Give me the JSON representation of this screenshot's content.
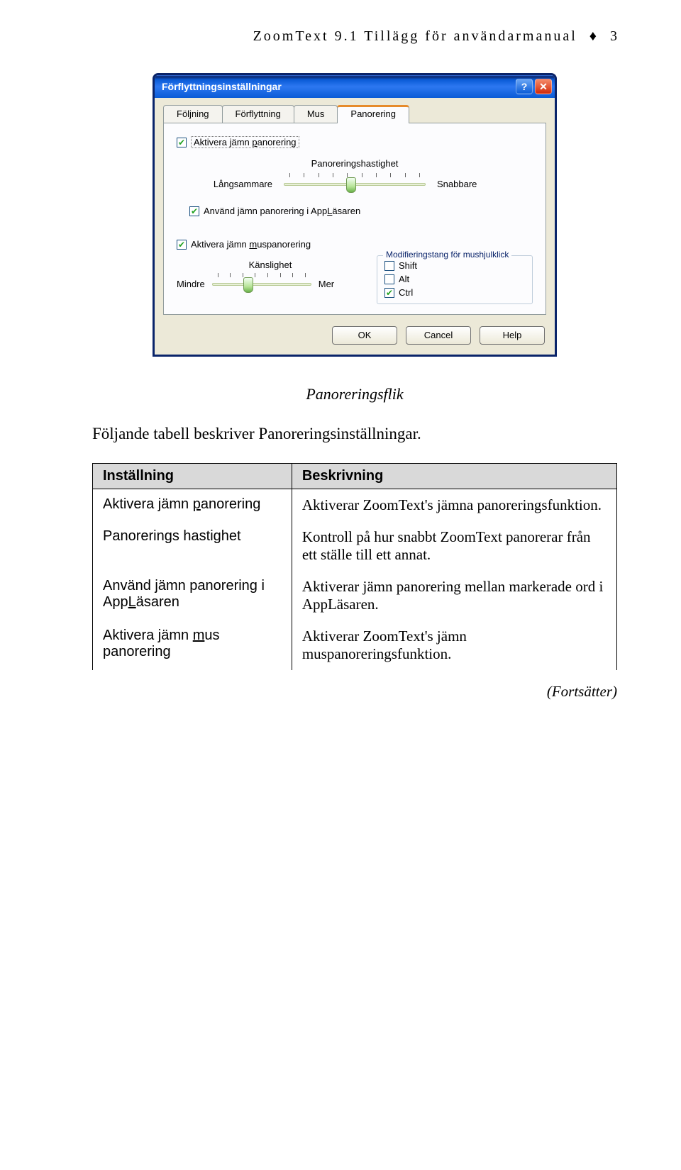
{
  "header": {
    "title": "ZoomText 9.1 Tillägg för användarmanual",
    "separator": "♦",
    "page_number": "3"
  },
  "dialog": {
    "title": "Förflyttningsinställningar",
    "tabs": [
      "Följning",
      "Förflyttning",
      "Mus",
      "Panorering"
    ],
    "active_tab": "Panorering",
    "cb_enable": "Aktivera jämn panorering",
    "group1_title": "Panoreringshastighet",
    "slider1_left": "Långsammare",
    "slider1_right": "Snabbare",
    "cb_applasaren": "Använd jämn panorering i AppLäsaren",
    "cb_mouse": "Aktivera jämn muspanorering",
    "sens_title": "Känslighet",
    "sens_left": "Mindre",
    "sens_right": "Mer",
    "mod_legend": "Modifieringstang för mushjulklick",
    "mod_shift": "Shift",
    "mod_alt": "Alt",
    "mod_ctrl": "Ctrl",
    "btn_ok": "OK",
    "btn_cancel": "Cancel",
    "btn_help": "Help"
  },
  "caption": "Panoreringsflik",
  "intro_text": "Följande tabell beskriver Panoreringsinställningar.",
  "table": {
    "header_setting": "Inställning",
    "header_desc": "Beskrivning",
    "rows": [
      {
        "term_pre": "Aktivera jämn ",
        "term_u": "p",
        "term_post": "anorering",
        "desc": "Aktiverar ZoomText's jämna panoreringsfunktion."
      },
      {
        "term_pre": "Panorerings hastighet",
        "term_u": "",
        "term_post": "",
        "desc": "Kontroll på hur snabbt ZoomText panorerar från ett ställe till ett annat."
      },
      {
        "term_pre": "Använd jämn panorering i App",
        "term_u": "L",
        "term_post": "äsaren",
        "desc": "Aktiverar jämn panorering mellan markerade ord i AppLäsaren."
      },
      {
        "term_pre": "Aktivera jämn ",
        "term_u": "m",
        "term_post": "us panorering",
        "desc": "Aktiverar ZoomText's jämn muspanoreringsfunktion."
      }
    ]
  },
  "continues": "(Fortsätter)"
}
